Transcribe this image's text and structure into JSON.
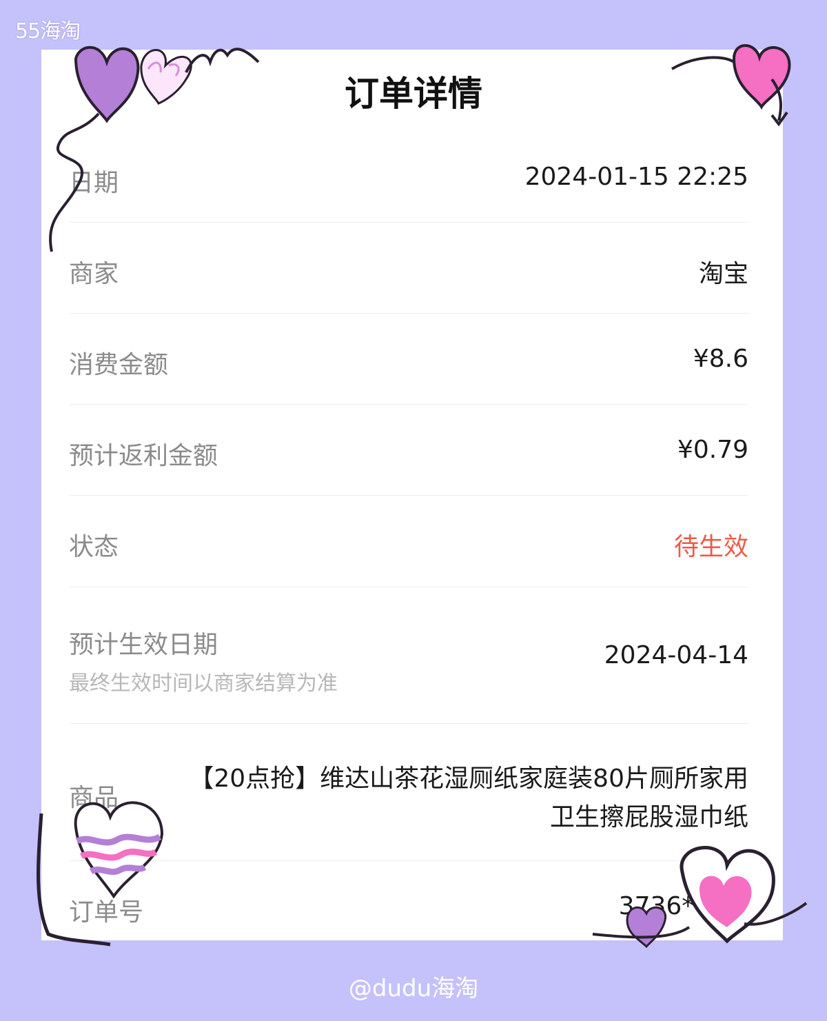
{
  "watermark": "55海淘",
  "title": "订单详情",
  "rows": [
    {
      "label": "日期",
      "value": "2024-01-15 22:25"
    },
    {
      "label": "商家",
      "value": "淘宝"
    },
    {
      "label": "消费金额",
      "value": "¥8.6"
    },
    {
      "label": "预计返利金额",
      "value": "¥0.79"
    },
    {
      "label": "状态",
      "value": "待生效"
    },
    {
      "label": "预计生效日期",
      "sub": "最终生效时间以商家结算为准",
      "value": "2024-04-14"
    },
    {
      "label": "商品",
      "value_line1": "【20点抢】维达山茶花湿厕纸家庭装80片厕所家用",
      "value_line2": "卫生擦屁股湿巾纸"
    },
    {
      "label": "订单号",
      "value": "3736***7c"
    }
  ],
  "footer": "@dudu海淘",
  "colors": {
    "background": "#c4c1fb",
    "status": "#ef5a47",
    "card": "#ffffff"
  }
}
